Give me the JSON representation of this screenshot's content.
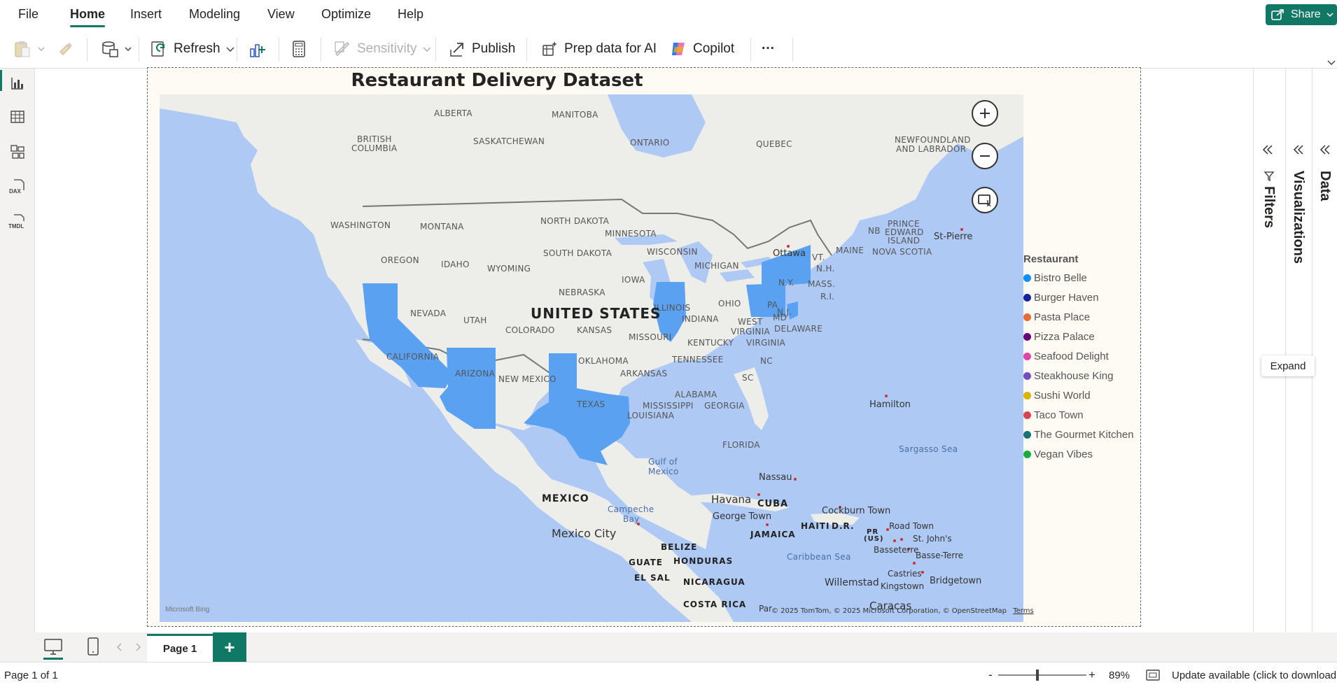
{
  "menu": {
    "items": [
      "File",
      "Home",
      "Insert",
      "Modeling",
      "View",
      "Optimize",
      "Help"
    ],
    "active": "Home",
    "share_label": "Share"
  },
  "ribbon": {
    "refresh_label": "Refresh",
    "sensitivity_label": "Sensitivity",
    "publish_label": "Publish",
    "prep_data_label": "Prep data for AI",
    "copilot_label": "Copilot",
    "more_label": "···"
  },
  "left_rail": {
    "views": [
      "report-view",
      "table-view",
      "model-view",
      "dax-query-view",
      "tmdl-view"
    ],
    "dax_text": "DAX",
    "tmdl_text": "TMDL"
  },
  "visual": {
    "title": "Restaurant Delivery Dataset",
    "map": {
      "highlighted_states": [
        "California",
        "Arizona",
        "Texas",
        "Illinois",
        "Pennsylvania",
        "New York",
        "New Jersey"
      ],
      "highlight_color": "#5aa1f2",
      "labels": {
        "alberta": "ALBERTA",
        "manitoba": "MANITOBA",
        "british_columbia_1": "BRITISH",
        "british_columbia_2": "COLUMBIA",
        "saskatchewan": "SASKATCHEWAN",
        "ontario": "ONTARIO",
        "quebec": "QUEBEC",
        "newfoundland_1": "NEWFOUNDLAND",
        "newfoundland_2": "AND LABRADOR",
        "washington": "WASHINGTON",
        "montana": "MONTANA",
        "north_dakota": "NORTH DAKOTA",
        "minnesota": "MINNESOTA",
        "south_dakota": "SOUTH DAKOTA",
        "wisconsin": "WISCONSIN",
        "michigan": "MICHIGAN",
        "oregon": "OREGON",
        "idaho": "IDAHO",
        "wyoming": "WYOMING",
        "iowa": "IOWA",
        "nebraska": "NEBRASKA",
        "nevada": "NEVADA",
        "utah": "UTAH",
        "colorado": "COLORADO",
        "kansas": "KANSAS",
        "missouri": "MISSOURI",
        "illinois": "ILLINOIS",
        "indiana": "INDIANA",
        "ohio": "OHIO",
        "kentucky": "KENTUCKY",
        "west_virginia_1": "WEST",
        "west_virginia_2": "VIRGINIA",
        "virginia": "VIRGINIA",
        "md": "MD",
        "delaware": "DELAWARE",
        "nj": "N.J.",
        "pa": "PA",
        "ny": "N.Y.",
        "vt": "VT.",
        "nh": "N.H.",
        "mass": "MASS.",
        "ri": "R.I.",
        "maine": "MAINE",
        "nb": "NB",
        "pei_1": "PRINCE",
        "pei_2": "EDWARD",
        "pei_3": "ISLAND",
        "nova_scotia": "NOVA SCOTIA",
        "st_pierre": "St-Pierre",
        "ottawa": "Ottawa",
        "united_states": "UNITED STATES",
        "california": "CALIFORNIA",
        "arizona": "ARIZONA",
        "new_mexico": "NEW MEXICO",
        "oklahoma": "OKLAHOMA",
        "arkansas": "ARKANSAS",
        "tennessee": "TENNESSEE",
        "nc": "NC",
        "sc": "SC",
        "texas": "TEXAS",
        "mississippi": "MISSISSIPPI",
        "alabama": "ALABAMA",
        "georgia": "GEORGIA",
        "louisiana": "LOUISIANA",
        "florida": "FLORIDA",
        "hamilton": "Hamilton",
        "sargasso_sea": "Sargasso Sea",
        "gulf_1": "Gulf of",
        "gulf_2": "Mexico",
        "nassau": "Nassau",
        "havana": "Havana",
        "cuba": "CUBA",
        "cockburn_town": "Cockburn Town",
        "george_town": "George Town",
        "jamaica": "JAMAICA",
        "haiti": "HAITI",
        "dr": "D.R.",
        "pr_1": "PR",
        "pr_2": "(US)",
        "road_town": "Road Town",
        "st_johns": "St. John's",
        "basseterre": "Basseterre",
        "basse_terre": "Basse-Terre",
        "mexico": "MEXICO",
        "mexico_city": "Mexico City",
        "campeche_1": "Campeche",
        "campeche_2": "Bay",
        "belize": "BELIZE",
        "guatemala": "GUATE",
        "honduras": "HONDURAS",
        "el_salvador": "EL SAL",
        "nicaragua": "NICARAGUA",
        "costa_rica": "COSTA RICA",
        "caribbean_sea": "Caribbean Sea",
        "willemstad": "Willemstad",
        "kingstown": "Kingstown",
        "castries": "Castries",
        "bridgetown": "Bridgetown",
        "caracas": "Caracas",
        "panama": "Par"
      },
      "attribution": "© 2025 TomTom, © 2025 Microsoft Corporation, © OpenStreetMap",
      "terms": "Terms",
      "bing_logo": "Microsoft Bing"
    },
    "legend": {
      "title": "Restaurant",
      "items": [
        {
          "label": "Bistro Belle",
          "color": "#118dff"
        },
        {
          "label": "Burger Haven",
          "color": "#12239e"
        },
        {
          "label": "Pasta Place",
          "color": "#e66c37"
        },
        {
          "label": "Pizza Palace",
          "color": "#6b007b"
        },
        {
          "label": "Seafood Delight",
          "color": "#e044a7"
        },
        {
          "label": "Steakhouse King",
          "color": "#744ec2"
        },
        {
          "label": "Sushi World",
          "color": "#d9b300"
        },
        {
          "label": "Taco Town",
          "color": "#d64550"
        },
        {
          "label": "The Gourmet Kitchen",
          "color": "#197278"
        },
        {
          "label": "Vegan Vibes",
          "color": "#1aab40"
        }
      ]
    }
  },
  "panes": {
    "filters": "Filters",
    "visualizations": "Visualizations",
    "data": "Data",
    "expand_tooltip": "Expand"
  },
  "pages": {
    "tabs": [
      "Page 1"
    ],
    "add_label": "+"
  },
  "status": {
    "page_info": "Page 1 of 1",
    "zoom_minus": "-",
    "zoom_plus": "+",
    "zoom_percent": 89,
    "zoom_label": "89%",
    "update_text": "Update available (click to download"
  },
  "colors": {
    "accent": "#117865",
    "map_water": "#aec9f3",
    "map_land": "#ededea",
    "highlight": "#5aa1f2"
  }
}
